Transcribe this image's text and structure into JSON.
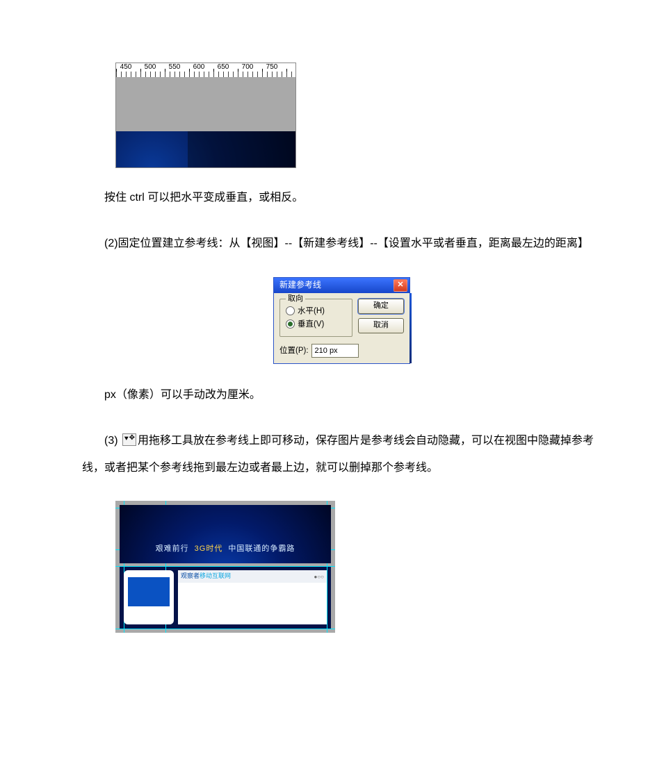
{
  "fig1": {
    "ruler_labels": {
      "a": "450",
      "b": "500",
      "c": "550",
      "d": "600",
      "e": "650",
      "f": "700",
      "g": "750"
    }
  },
  "para1": "按住 ctrl 可以把水平变成垂直，或相反。",
  "para2": "(2)固定位置建立参考线：从【视图】--【新建参考线】--【设置水平或者垂直，距离最左边的距离】",
  "dialog": {
    "title": "新建参考线",
    "group_legend": "取向",
    "radio_h": "水平(H)",
    "radio_v": "垂直(V)",
    "pos_label": "位置(P):",
    "pos_value": "210 px",
    "ok": "确定",
    "cancel": "取消",
    "close_glyph": "✕"
  },
  "para3": "px（像素）可以手动改为厘米。",
  "para4_a": "(3) ",
  "para4_b": "用拖移工具放在参考线上即可移动，保存图片是参考线会自动隐藏，可以在视图中隐藏掉参考线，或者把某个参考线拖到最左边或者最上边，就可以删掉那个参考线。",
  "fig3": {
    "headline_a": "艰难前行",
    "headline_b": "3G时代",
    "headline_c": "中国联通的争霸路",
    "logo_a": "观察者",
    "logo_b": "移动互联网",
    "badge": "●○○"
  }
}
